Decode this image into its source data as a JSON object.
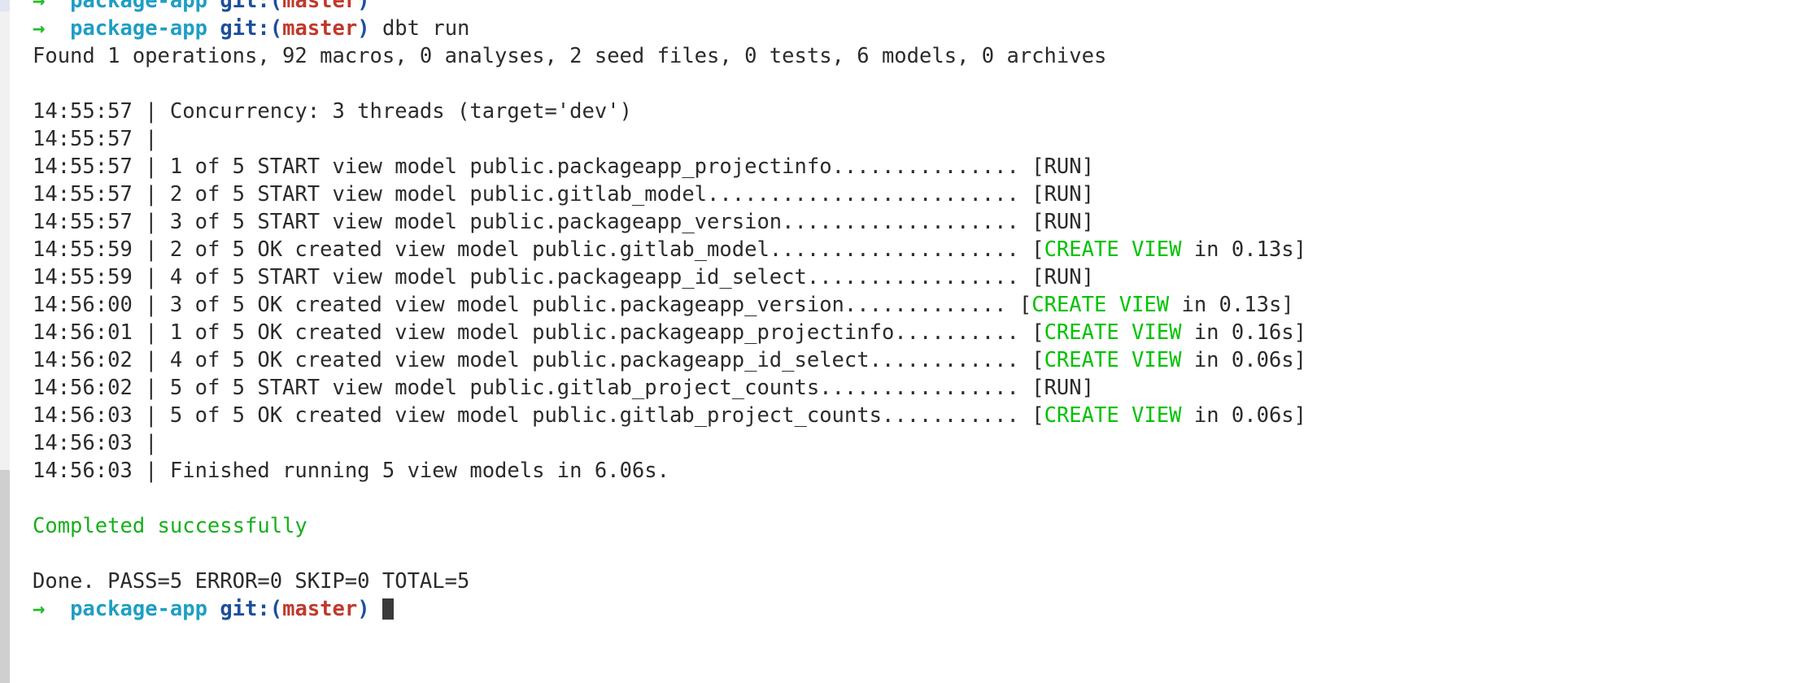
{
  "window": {
    "kind": "terminal-emulator",
    "background_color": "#ffffff",
    "foreground_color": "#2b2b2b"
  },
  "scrollbar": {
    "name": "vertical-scrollbar",
    "track_color": "#f1f1f1",
    "thumb_color": "#cfcfcf",
    "top_mark_color": "#e2e5f2"
  },
  "colors": {
    "green": "#17b01b",
    "bright_green": "#00c200",
    "cyan": "#1f9ec4",
    "blue": "#1c4f9c",
    "red": "#c0392b",
    "default": "#2b2b2b"
  },
  "prompt": {
    "arrow": "→",
    "directory": "package-app",
    "git_label": "git:",
    "paren_open": "(",
    "branch": "master",
    "paren_close": ")",
    "command": "dbt run"
  },
  "lines": [
    {
      "id": "prompt-scrolled",
      "type": "prompt",
      "clipped": true,
      "command": ""
    },
    {
      "id": "prompt-command",
      "type": "prompt",
      "clipped": false,
      "command": "dbt run"
    },
    {
      "id": "found-summary",
      "type": "plain",
      "text": "Found 1 operations, 92 macros, 0 analyses, 2 seed files, 0 tests, 6 models, 0 archives"
    },
    {
      "id": "blank-1",
      "type": "blank"
    },
    {
      "id": "log-concurrency",
      "type": "log",
      "time": "14:55:57",
      "body": "Concurrency: 3 threads (target='dev')"
    },
    {
      "id": "log-empty-1",
      "type": "log",
      "time": "14:55:57",
      "body": ""
    },
    {
      "id": "log-start-1",
      "type": "log-status",
      "time": "14:55:57",
      "body": "1 of 5 START view model public.packageapp_projectinfo",
      "dots": "...............",
      "bracket_open": "[",
      "status": "RUN",
      "status_color": "default",
      "bracket_tail": "]"
    },
    {
      "id": "log-start-2",
      "type": "log-status",
      "time": "14:55:57",
      "body": "2 of 5 START view model public.gitlab_model",
      "dots": ".........................",
      "bracket_open": "[",
      "status": "RUN",
      "status_color": "default",
      "bracket_tail": "]"
    },
    {
      "id": "log-start-3",
      "type": "log-status",
      "time": "14:55:57",
      "body": "3 of 5 START view model public.packageapp_version",
      "dots": "...................",
      "bracket_open": "[",
      "status": "RUN",
      "status_color": "default",
      "bracket_tail": "]"
    },
    {
      "id": "log-ok-2",
      "type": "log-status",
      "time": "14:55:59",
      "body": "2 of 5 OK created view model public.gitlab_model",
      "dots": "....................",
      "bracket_open": "[",
      "status": "CREATE VIEW",
      "status_color": "bright_green",
      "bracket_tail": " in 0.13s]"
    },
    {
      "id": "log-start-4",
      "type": "log-status",
      "time": "14:55:59",
      "body": "4 of 5 START view model public.packageapp_id_select",
      "dots": ".................",
      "bracket_open": "[",
      "status": "RUN",
      "status_color": "default",
      "bracket_tail": "]"
    },
    {
      "id": "log-ok-3",
      "type": "log-status",
      "time": "14:56:00",
      "body": "3 of 5 OK created view model public.packageapp_version",
      "dots": ".............",
      "bracket_open": "[",
      "status": "CREATE VIEW",
      "status_color": "bright_green",
      "bracket_tail": " in 0.13s]"
    },
    {
      "id": "log-ok-1",
      "type": "log-status",
      "time": "14:56:01",
      "body": "1 of 5 OK created view model public.packageapp_projectinfo",
      "dots": "..........",
      "bracket_open": "[",
      "status": "CREATE VIEW",
      "status_color": "bright_green",
      "bracket_tail": " in 0.16s]"
    },
    {
      "id": "log-ok-4",
      "type": "log-status",
      "time": "14:56:02",
      "body": "4 of 5 OK created view model public.packageapp_id_select",
      "dots": "............",
      "bracket_open": "[",
      "status": "CREATE VIEW",
      "status_color": "bright_green",
      "bracket_tail": " in 0.06s]"
    },
    {
      "id": "log-start-5",
      "type": "log-status",
      "time": "14:56:02",
      "body": "5 of 5 START view model public.gitlab_project_counts",
      "dots": "................",
      "bracket_open": "[",
      "status": "RUN",
      "status_color": "default",
      "bracket_tail": "]"
    },
    {
      "id": "log-ok-5",
      "type": "log-status",
      "time": "14:56:03",
      "body": "5 of 5 OK created view model public.gitlab_project_counts",
      "dots": "...........",
      "bracket_open": "[",
      "status": "CREATE VIEW",
      "status_color": "bright_green",
      "bracket_tail": " in 0.06s]"
    },
    {
      "id": "log-empty-2",
      "type": "log",
      "time": "14:56:03",
      "body": ""
    },
    {
      "id": "log-finished",
      "type": "log",
      "time": "14:56:03",
      "body": "Finished running 5 view models in 6.06s."
    },
    {
      "id": "blank-2",
      "type": "blank"
    },
    {
      "id": "completed",
      "type": "plain-green",
      "text": "Completed successfully"
    },
    {
      "id": "blank-3",
      "type": "blank"
    },
    {
      "id": "done-summary",
      "type": "plain",
      "text": "Done. PASS=5 ERROR=0 SKIP=0 TOTAL=5"
    },
    {
      "id": "prompt-final",
      "type": "prompt-cursor",
      "clipped": false,
      "command": ""
    }
  ]
}
